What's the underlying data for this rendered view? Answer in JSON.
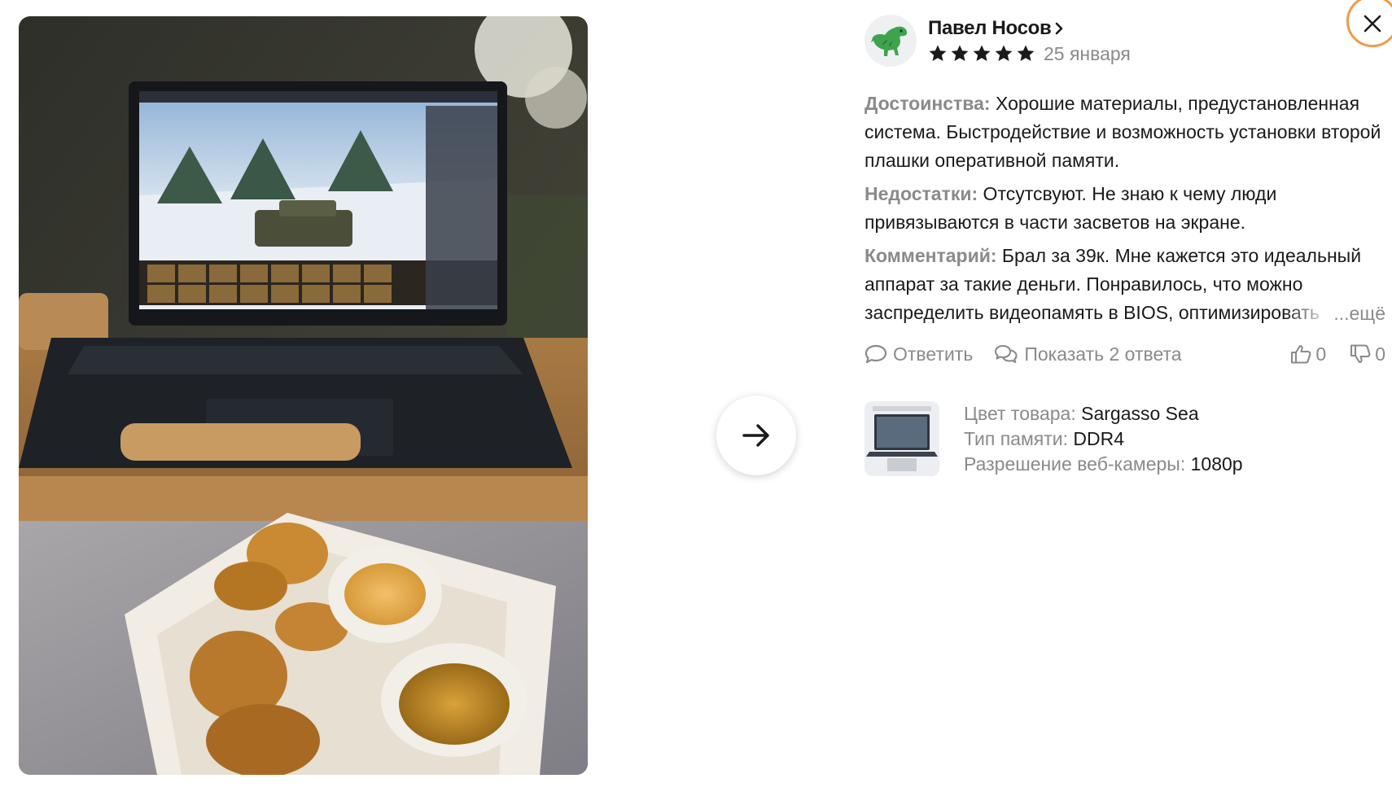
{
  "review": {
    "author": {
      "name": "Павел Носов",
      "avatar_icon": "dinosaur-icon"
    },
    "rating": 5,
    "max_rating": 5,
    "date": "25 января",
    "pros": {
      "label": "Достоинства:",
      "text": " Хорошие материалы, предустановленная система. Быстродействие и возможность установки второй плашки оперативной памяти."
    },
    "cons": {
      "label": "Недостатки:",
      "text": " Отсутсвуют. Не знаю к чему люди привязываются в части засветов на экране."
    },
    "comment": {
      "label": "Комментарий:",
      "text": " Брал за 39к. Мне кажется это идеальный аппарат за такие деньги. Понравилось, что можно заспределить видеопамять в BIOS, оптимизировать систему.",
      "more": "...ещё"
    },
    "actions": {
      "reply": "Ответить",
      "show_replies": "Показать 2 ответа",
      "likes": "0",
      "dislikes": "0"
    },
    "product": {
      "specs": [
        {
          "key": "Цвет товара:",
          "value": "Sargasso Sea"
        },
        {
          "key": "Тип памяти:",
          "value": "DDR4"
        },
        {
          "key": "Разрешение веб-камеры:",
          "value": "1080p"
        }
      ]
    }
  },
  "colors": {
    "muted": "#8a8a8a",
    "star": "#1a1a1a",
    "close_ring": "#f09a4a"
  }
}
